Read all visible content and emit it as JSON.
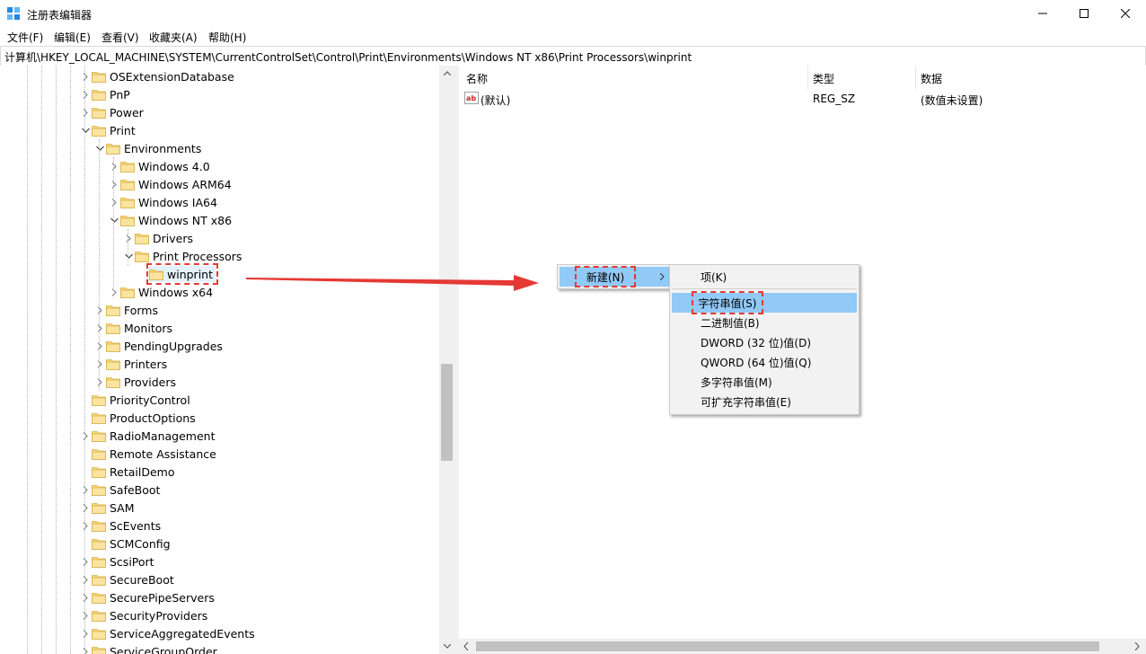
{
  "window": {
    "title": "注册表编辑器"
  },
  "menu": [
    "文件(F)",
    "编辑(E)",
    "查看(V)",
    "收藏夹(A)",
    "帮助(H)"
  ],
  "address": "计算机\\HKEY_LOCAL_MACHINE\\SYSTEM\\CurrentControlSet\\Control\\Print\\Environments\\Windows NT x86\\Print Processors\\winprint",
  "tree": [
    {
      "label": "OSExtensionDatabase",
      "level": 0,
      "expander": "collapsed"
    },
    {
      "label": "PnP",
      "level": 0,
      "expander": "collapsed"
    },
    {
      "label": "Power",
      "level": 0,
      "expander": "collapsed"
    },
    {
      "label": "Print",
      "level": 0,
      "expander": "expanded"
    },
    {
      "label": "Environments",
      "level": 1,
      "expander": "expanded"
    },
    {
      "label": "Windows 4.0",
      "level": 2,
      "expander": "collapsed"
    },
    {
      "label": "Windows ARM64",
      "level": 2,
      "expander": "collapsed"
    },
    {
      "label": "Windows IA64",
      "level": 2,
      "expander": "collapsed"
    },
    {
      "label": "Windows NT x86",
      "level": 2,
      "expander": "expanded"
    },
    {
      "label": "Drivers",
      "level": 3,
      "expander": "collapsed"
    },
    {
      "label": "Print Processors",
      "level": 3,
      "expander": "expanded"
    },
    {
      "label": "winprint",
      "level": 4,
      "expander": "none",
      "selected": true
    },
    {
      "label": "Windows x64",
      "level": 2,
      "expander": "collapsed"
    },
    {
      "label": "Forms",
      "level": 1,
      "expander": "collapsed"
    },
    {
      "label": "Monitors",
      "level": 1,
      "expander": "collapsed"
    },
    {
      "label": "PendingUpgrades",
      "level": 1,
      "expander": "collapsed"
    },
    {
      "label": "Printers",
      "level": 1,
      "expander": "collapsed"
    },
    {
      "label": "Providers",
      "level": 1,
      "expander": "collapsed"
    },
    {
      "label": "PriorityControl",
      "level": 0,
      "expander": "none"
    },
    {
      "label": "ProductOptions",
      "level": 0,
      "expander": "none"
    },
    {
      "label": "RadioManagement",
      "level": 0,
      "expander": "collapsed"
    },
    {
      "label": "Remote Assistance",
      "level": 0,
      "expander": "none"
    },
    {
      "label": "RetailDemo",
      "level": 0,
      "expander": "none"
    },
    {
      "label": "SafeBoot",
      "level": 0,
      "expander": "collapsed"
    },
    {
      "label": "SAM",
      "level": 0,
      "expander": "collapsed"
    },
    {
      "label": "ScEvents",
      "level": 0,
      "expander": "collapsed"
    },
    {
      "label": "SCMConfig",
      "level": 0,
      "expander": "none"
    },
    {
      "label": "ScsiPort",
      "level": 0,
      "expander": "collapsed"
    },
    {
      "label": "SecureBoot",
      "level": 0,
      "expander": "collapsed"
    },
    {
      "label": "SecurePipeServers",
      "level": 0,
      "expander": "collapsed"
    },
    {
      "label": "SecurityProviders",
      "level": 0,
      "expander": "collapsed"
    },
    {
      "label": "ServiceAggregatedEvents",
      "level": 0,
      "expander": "collapsed"
    },
    {
      "label": "ServiceGroupOrder",
      "level": 0,
      "expander": "collapsed"
    }
  ],
  "list": {
    "columns": [
      "名称",
      "类型",
      "数据"
    ],
    "rows": [
      {
        "name": "(默认)",
        "type": "REG_SZ",
        "data": "(数值未设置)",
        "icon": "string-value-icon"
      }
    ]
  },
  "context_menu": {
    "new_label": "新建(N)",
    "submenu": [
      "项(K)",
      "字符串值(S)",
      "二进制值(B)",
      "DWORD (32 位)值(D)",
      "QWORD (64 位)值(Q)",
      "多字符串值(M)",
      "可扩充字符串值(E)"
    ],
    "highlighted": "字符串值(S)"
  },
  "colors": {
    "highlight": "#91c9f7",
    "annotation": "#e53935",
    "folder": "#f8d775"
  }
}
